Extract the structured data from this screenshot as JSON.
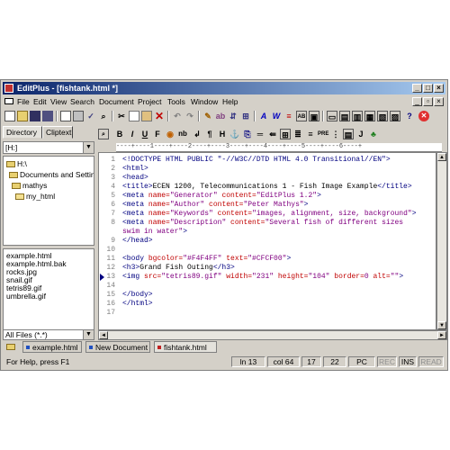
{
  "window": {
    "title": "EditPlus - [fishtank.html *]"
  },
  "menu": [
    "File",
    "Edit",
    "View",
    "Search",
    "Document",
    "Project",
    "Tools",
    "Window",
    "Help"
  ],
  "left_panel": {
    "tabs": [
      "Directory",
      "Cliptext"
    ],
    "drive": "[H:]",
    "tree": [
      "H:\\",
      "Documents and Settings",
      "mathys",
      "my_html"
    ],
    "files": [
      "example.html",
      "example.html.bak",
      "rocks.jpg",
      "snail.gif",
      "tetris89.gif",
      "umbrella.gif"
    ],
    "filter": "All Files (*.*)"
  },
  "ruler": "----+----1----+----2----+----3----+----4----+----5----+----6----+",
  "editor": {
    "line_numbers": [
      "1",
      "2",
      "3",
      "4",
      "5",
      "6",
      "7",
      "8",
      "",
      "9",
      "10",
      "11",
      "12",
      "13",
      "14",
      "15",
      "16",
      "17"
    ],
    "lines": [
      [
        [
          "t",
          "<!DOCTYPE HTML PUBLIC \"-//W3C//DTD HTML 4.0 Transitional//EN\">"
        ]
      ],
      [
        [
          "t",
          "<html>"
        ]
      ],
      [
        [
          "t",
          "<head>"
        ]
      ],
      [
        [
          "t",
          "<title>"
        ],
        [
          "tx",
          "ECEN 1200, Telecommunications 1 - Fish Image Example"
        ],
        [
          "t",
          "</title>"
        ]
      ],
      [
        [
          "t",
          "<meta "
        ],
        [
          "a",
          "name="
        ],
        [
          "v",
          "\"Generator\""
        ],
        [
          "a",
          " content="
        ],
        [
          "v",
          "\"EditPlus 1.2\""
        ],
        [
          "t",
          ">"
        ]
      ],
      [
        [
          "t",
          "<meta "
        ],
        [
          "a",
          "name="
        ],
        [
          "v",
          "\"Author\""
        ],
        [
          "a",
          " content="
        ],
        [
          "v",
          "\"Peter Mathys\""
        ],
        [
          "t",
          ">"
        ]
      ],
      [
        [
          "t",
          "<meta "
        ],
        [
          "a",
          "name="
        ],
        [
          "v",
          "\"Keywords\""
        ],
        [
          "a",
          " content="
        ],
        [
          "v",
          "\"images, alignment, size, background\""
        ],
        [
          "t",
          ">"
        ]
      ],
      [
        [
          "t",
          "<meta "
        ],
        [
          "a",
          "name="
        ],
        [
          "v",
          "\"Description\""
        ],
        [
          "a",
          " content="
        ],
        [
          "v",
          "\"Several fish of different sizes"
        ]
      ],
      [
        [
          "v",
          "swim in water\""
        ],
        [
          "t",
          ">"
        ]
      ],
      [
        [
          "t",
          "</head>"
        ]
      ],
      [],
      [
        [
          "t",
          "<body "
        ],
        [
          "a",
          "bgcolor="
        ],
        [
          "v",
          "\"#F4F4FF\""
        ],
        [
          "a",
          " text="
        ],
        [
          "v",
          "\"#CFCF00\""
        ],
        [
          "t",
          ">"
        ]
      ],
      [
        [
          "t",
          "<h3>"
        ],
        [
          "tx",
          "Grand Fish Outing"
        ],
        [
          "t",
          "</h3>"
        ]
      ],
      [
        [
          "t",
          "<img "
        ],
        [
          "a",
          "src="
        ],
        [
          "v",
          "\"tetris89.gif\""
        ],
        [
          "a",
          " width="
        ],
        [
          "v",
          "\"231\""
        ],
        [
          "a",
          " height="
        ],
        [
          "v",
          "\"104\""
        ],
        [
          "a",
          " border="
        ],
        [
          "v",
          "0"
        ],
        [
          "a",
          " alt="
        ],
        [
          "v",
          "\"\""
        ],
        [
          "t",
          ">"
        ]
      ],
      [],
      [
        [
          "t",
          "</body>"
        ]
      ],
      [
        [
          "t",
          "</html>"
        ]
      ],
      []
    ]
  },
  "doc_tabs": [
    "example.html",
    "New Document",
    "fishtank.html"
  ],
  "status": {
    "help": "For Help, press F1",
    "line": "ln 13",
    "col": "col 64",
    "c1": "17",
    "c2": "22",
    "mode": "PC",
    "rec": "REC",
    "ins": "INS",
    "read": "READ"
  },
  "colors": {
    "title_start": "#0a246a",
    "title_end": "#a6caf0",
    "tag": "#000080",
    "attr": "#c00000",
    "value": "#800080"
  }
}
